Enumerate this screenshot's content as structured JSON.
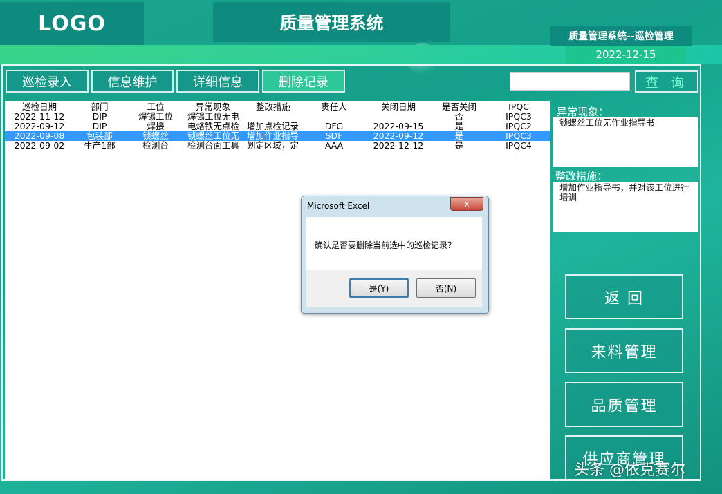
{
  "header": {
    "logo": "LOGO",
    "title": "质量管理系统",
    "subtitle": "质量管理系统--巡检管理",
    "date": "2022-12-15"
  },
  "toolbar": {
    "buttons": [
      "巡检录入",
      "信息维护",
      "详细信息",
      "删除记录"
    ],
    "active_index": 3,
    "search_value": "",
    "search_label": "查 询"
  },
  "table": {
    "columns": [
      "巡检日期",
      "部门",
      "工位",
      "异常现象",
      "整改措施",
      "责任人",
      "关闭日期",
      "是否关闭",
      "IPQC"
    ],
    "rows": [
      [
        "2022-11-12",
        "DIP",
        "焊锡工位",
        "焊锡工位无电",
        "",
        "",
        "",
        "否",
        "IPQC3"
      ],
      [
        "2022-09-12",
        "DIP",
        "焊接",
        "电烙铁无点检",
        "增加点检记录",
        "DFG",
        "2022-09-15",
        "是",
        "IPQC2"
      ],
      [
        "2022-09-08",
        "包装部",
        "锁螺丝",
        "锁螺丝工位无",
        "增加作业指导",
        "SDF",
        "2022-09-12",
        "是",
        "IPQC3"
      ],
      [
        "2022-09-02",
        "生产1部",
        "检测台",
        "检测台面工具",
        "划定区域，定",
        "AAA",
        "2022-12-12",
        "是",
        "IPQC4"
      ]
    ],
    "selected_index": 2
  },
  "side": {
    "anomaly_label": "异常现象：",
    "anomaly_text": "锁螺丝工位无作业指导书",
    "measure_label": "整改措施：",
    "measure_text": "增加作业指导书，并对该工位进行培训"
  },
  "nav": [
    "返 回",
    "来料管理",
    "品质管理",
    "供应商管理"
  ],
  "dialog": {
    "title": "Microsoft Excel",
    "close": "x",
    "message": "确认是否要删除当前选中的巡检记录？",
    "yes": "是(Y)",
    "no": "否(N)"
  },
  "watermark": "头条 @依克赛尔",
  "colors": {
    "background": "#14a08a",
    "header_box": "#0e8a7e",
    "selected_row": "#3399ff",
    "active_button": "#2ec79a"
  }
}
